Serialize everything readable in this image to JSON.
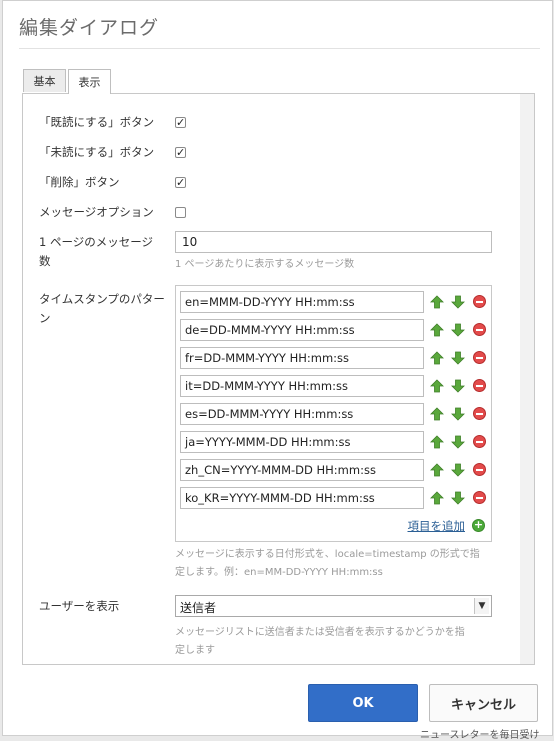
{
  "dialog": {
    "title": "編集ダイアログ",
    "tabs": [
      {
        "label": "基本"
      },
      {
        "label": "表示"
      }
    ],
    "fields": {
      "mark_read": {
        "label": "「既読にする」ボタン",
        "checked": true
      },
      "mark_unread": {
        "label": "「未読にする」ボタン",
        "checked": true
      },
      "delete": {
        "label": "「削除」ボタン",
        "checked": true
      },
      "message_options": {
        "label": "メッセージオプション",
        "checked": false
      },
      "messages_per_page": {
        "label_line1": "1 ページのメッセージ",
        "label_line2": "数",
        "value": "10",
        "help": "1 ページあたりに表示するメッセージ数"
      },
      "timestamp_pattern": {
        "label_line1": "タイムスタンプのパター",
        "label_line2": "ン",
        "items": [
          "en=MMM-DD-YYYY HH:mm:ss",
          "de=DD-MMM-YYYY HH:mm:ss",
          "fr=DD-MMM-YYYY HH:mm:ss",
          "it=DD-MMM-YYYY HH:mm:ss",
          "es=DD-MMM-YYYY HH:mm:ss",
          "ja=YYYY-MMM-DD HH:mm:ss",
          "zh_CN=YYYY-MMM-DD HH:mm:ss",
          "ko_KR=YYYY-MMM-DD HH:mm:ss"
        ],
        "add_label": "項目を追加",
        "help_line1": "メッセージに表示する日付形式を、locale=timestamp の形式で指",
        "help_line2": "定します。例：en=MM-DD-YYYY HH:mm:ss"
      },
      "show_user": {
        "label": "ユーザーを表示",
        "value": "送信者",
        "help_line1": "メッセージリストに送信者または受信者を表示するかどうかを指",
        "help_line2": "定します"
      }
    },
    "buttons": {
      "ok": "OK",
      "cancel": "キャンセル"
    },
    "background_text": "ニュースレターを毎日受け"
  },
  "colors": {
    "primary_button": "#326ec8",
    "up_arrow": "#5aa83c",
    "down_arrow": "#5aa83c",
    "remove": "#e34b4b",
    "add": "#4caa3a",
    "link": "#2b5f95"
  }
}
